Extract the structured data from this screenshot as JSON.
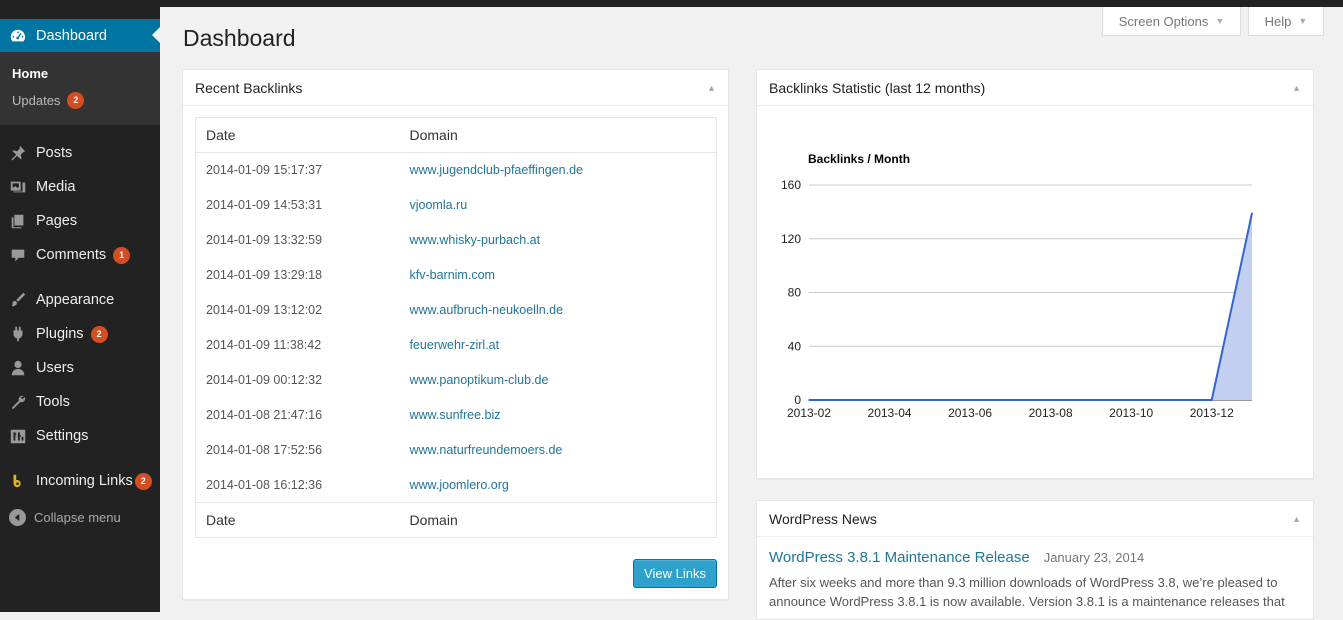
{
  "sidebar": {
    "dashboard_label": "Dashboard",
    "submenu": {
      "home_label": "Home",
      "updates_label": "Updates",
      "updates_count": "2"
    },
    "items": [
      {
        "label": "Posts",
        "icon": "pin-icon"
      },
      {
        "label": "Media",
        "icon": "media-icon"
      },
      {
        "label": "Pages",
        "icon": "pages-icon"
      },
      {
        "label": "Comments",
        "icon": "comment-icon",
        "count": "1"
      },
      {
        "label": "Appearance",
        "icon": "brush-icon"
      },
      {
        "label": "Plugins",
        "icon": "plug-icon",
        "count": "2"
      },
      {
        "label": "Users",
        "icon": "user-icon"
      },
      {
        "label": "Tools",
        "icon": "wrench-icon"
      },
      {
        "label": "Settings",
        "icon": "settings-icon"
      },
      {
        "label": "Incoming Links",
        "icon": "incoming-links-icon",
        "count": "2"
      }
    ],
    "collapse_label": "Collapse menu"
  },
  "header": {
    "page_title": "Dashboard",
    "screen_options_label": "Screen Options",
    "help_label": "Help"
  },
  "recent_backlinks": {
    "title": "Recent Backlinks",
    "columns": [
      "Date",
      "Domain"
    ],
    "rows": [
      {
        "date": "2014-01-09 15:17:37",
        "domain": "www.jugendclub-pfaeffingen.de"
      },
      {
        "date": "2014-01-09 14:53:31",
        "domain": "vjoomla.ru"
      },
      {
        "date": "2014-01-09 13:32:59",
        "domain": "www.whisky-purbach.at"
      },
      {
        "date": "2014-01-09 13:29:18",
        "domain": "kfv-barnim.com"
      },
      {
        "date": "2014-01-09 13:12:02",
        "domain": "www.aufbruch-neukoelln.de"
      },
      {
        "date": "2014-01-09 11:38:42",
        "domain": "feuerwehr-zirl.at"
      },
      {
        "date": "2014-01-09 00:12:32",
        "domain": "www.panoptikum-club.de"
      },
      {
        "date": "2014-01-08 21:47:16",
        "domain": "www.sunfree.biz"
      },
      {
        "date": "2014-01-08 17:52:56",
        "domain": "www.naturfreundemoers.de"
      },
      {
        "date": "2014-01-08 16:12:36",
        "domain": "www.joomlero.org"
      }
    ],
    "view_links_label": "View Links"
  },
  "backlinks_statistic": {
    "title": "Backlinks Statistic (last 12 months)"
  },
  "chart_data": {
    "type": "area",
    "title": "Backlinks / Month",
    "x": [
      "2013-02",
      "2013-03",
      "2013-04",
      "2013-05",
      "2013-06",
      "2013-07",
      "2013-08",
      "2013-09",
      "2013-10",
      "2013-11",
      "2013-12",
      "2014-01"
    ],
    "x_tick_labels": [
      "2013-02",
      "2013-04",
      "2013-06",
      "2013-08",
      "2013-10",
      "2013-12"
    ],
    "series": [
      {
        "values": [
          0,
          0,
          0,
          0,
          0,
          0,
          0,
          0,
          0,
          0,
          0,
          139
        ]
      }
    ],
    "y_ticks": [
      0,
      40,
      80,
      120,
      160
    ],
    "ylim": [
      0,
      160
    ],
    "grid": true,
    "colors": {
      "line": "#3366cc",
      "fill": "#c2cff0"
    }
  },
  "wordpress_news": {
    "title": "WordPress News",
    "headline": "WordPress 3.8.1 Maintenance Release",
    "date": "January 23, 2014",
    "excerpt": "After six weeks and more than 9.3 million downloads of WordPress 3.8, we’re pleased to announce WordPress 3.8.1 is now available. Version 3.8.1 is a maintenance releases that"
  }
}
